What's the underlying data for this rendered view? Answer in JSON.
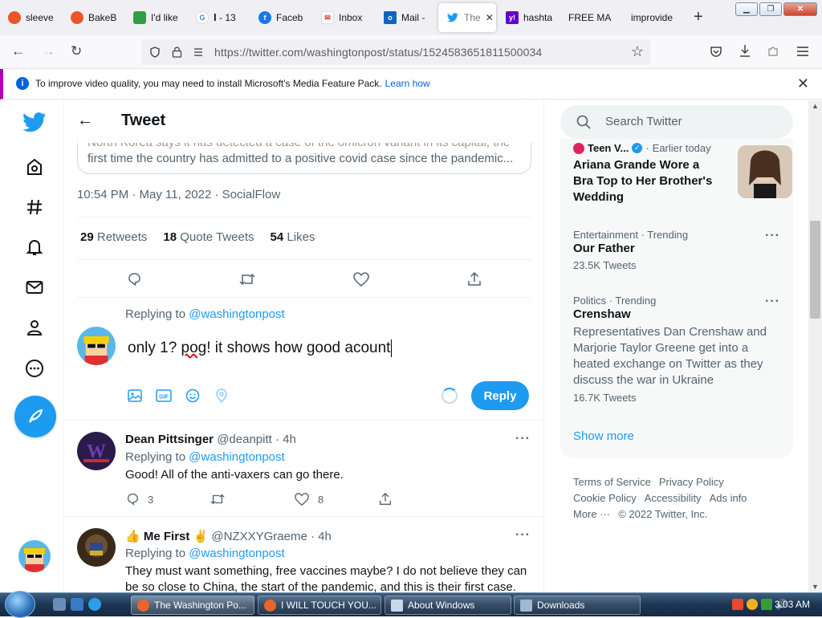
{
  "browser": {
    "tabs": [
      {
        "label": "sleeve",
        "color": "#e8562a"
      },
      {
        "label": "BakeB",
        "color": "#e8562a"
      },
      {
        "label": "I'd like",
        "color": "#2ea043"
      },
      {
        "label": "𝐈 - 13",
        "color": "#4285f4"
      },
      {
        "label": "Faceb",
        "color": "#1877f2"
      },
      {
        "label": "Inbox",
        "color": "#d93025"
      },
      {
        "label": "Mail -",
        "color": "#0a66c2"
      },
      {
        "label": "The",
        "color": "#1d9bf0"
      },
      {
        "label": "hashta",
        "color": "#6001d2"
      },
      {
        "label": "FREE MA",
        "color": ""
      },
      {
        "label": "improvide",
        "color": ""
      }
    ],
    "url": "https://twitter.com/washingtonpost/status/1524583651811500034",
    "infobar": {
      "message": "To improve video quality, you may need to install Microsoft's Media Feature Pack.",
      "link": "Learn how"
    }
  },
  "header": {
    "title": "Tweet"
  },
  "tweet": {
    "quote_line1": "North Korea says it has detected a case of the omicron variant in its capital, the",
    "quote_line2": "first time the country has admitted to a positive covid case since the pandemic...",
    "timestamp": "10:54 PM · May 11, 2022 · SocialFlow",
    "retweets": "29",
    "retweets_label": "Retweets",
    "quotes": "18",
    "quotes_label": "Quote Tweets",
    "likes": "54",
    "likes_label": "Likes"
  },
  "compose": {
    "replying_prefix": "Replying to",
    "replying_handle": "@washingtonpost",
    "text_a": "only 1? ",
    "text_b": "pog",
    "text_c": "! it shows how good acount",
    "reply_label": "Reply"
  },
  "replies": [
    {
      "name": "Dean Pittsinger",
      "handle": "@deanpitt",
      "time": "4h",
      "replying_prefix": "Replying to",
      "replying_handle": "@washingtonpost",
      "text": "Good!  All of the anti-vaxers can go there.",
      "reply_count": "3",
      "like_count": "8"
    },
    {
      "name": "Me First",
      "handle": "@NZXXYGraeme",
      "time": "4h",
      "replying_prefix": "Replying to",
      "replying_handle": "@washingtonpost",
      "text": "They must want something, free vaccines maybe?  I do not believe they can be so close to China, the start of the pandemic, and this is their first case."
    }
  ],
  "sidebar": {
    "search_placeholder": "Search Twitter",
    "trends": [
      {
        "source": "Teen V...",
        "when": "Earlier today",
        "headline": "Ariana Grande Wore a Bra Top to Her Brother's Wedding"
      },
      {
        "meta": "Entertainment · Trending",
        "title": "Our Father",
        "count": "23.5K Tweets"
      },
      {
        "meta": "Politics · Trending",
        "title": "Crenshaw",
        "desc": "Representatives Dan Crenshaw and Marjorie Taylor Greene get into a heated exchange on Twitter as they discuss the war in Ukraine",
        "count": "16.7K Tweets"
      }
    ],
    "show_more": "Show more",
    "footer": [
      "Terms of Service",
      "Privacy Policy",
      "Cookie Policy",
      "Accessibility",
      "Ads info",
      "More ···",
      "© 2022 Twitter, Inc."
    ]
  },
  "taskbar": {
    "items": [
      "The Washington Po...",
      "I WILL TOUCH YOU...",
      "About Windows",
      "Downloads"
    ],
    "clock": "3:03 AM"
  },
  "colors": {
    "accent": "#1d9bf0",
    "text": "#0f1419",
    "muted": "#536471"
  }
}
